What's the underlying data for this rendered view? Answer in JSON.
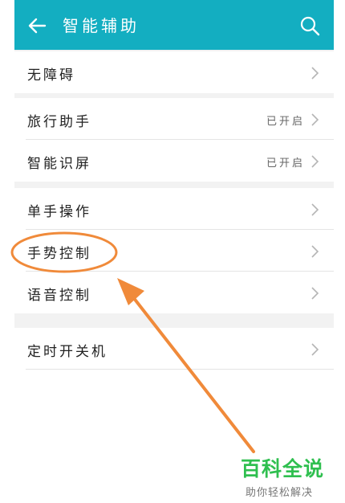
{
  "header": {
    "title": "智能辅助",
    "back_icon": "arrow-left-icon",
    "search_icon": "search-icon",
    "color": "#13aec1"
  },
  "groups": [
    {
      "items": [
        {
          "label": "无障碍",
          "status": ""
        }
      ]
    },
    {
      "items": [
        {
          "label": "旅行助手",
          "status": "已开启"
        },
        {
          "label": "智能识屏",
          "status": "已开启"
        }
      ]
    },
    {
      "items": [
        {
          "label": "单手操作",
          "status": ""
        },
        {
          "label": "手势控制",
          "status": ""
        },
        {
          "label": "语音控制",
          "status": ""
        }
      ]
    },
    {
      "items": [
        {
          "label": "定时开关机",
          "status": ""
        }
      ]
    }
  ],
  "annotation": {
    "color": "#f08a3a"
  },
  "watermark": {
    "title": "百科全说",
    "subtitle": "助你轻松解决"
  }
}
